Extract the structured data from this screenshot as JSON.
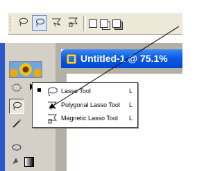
{
  "document": {
    "title": "Untitled-1 @ 75.1%"
  },
  "flyout_menu": {
    "items": [
      {
        "label": "Lasso Tool",
        "shortcut": "L",
        "icon": "lasso-icon",
        "active": true
      },
      {
        "label": "Polygonal Lasso Tool",
        "shortcut": "L",
        "icon": "polygonal-lasso-icon",
        "active": false
      },
      {
        "label": "Magnetic Lasso Tool",
        "shortcut": "L",
        "icon": "magnetic-lasso-icon",
        "active": false
      }
    ]
  },
  "options_bar": {
    "tool_icons": [
      "lasso-icon",
      "polygonal-lasso-icon",
      "magnetic-lasso-icon"
    ],
    "selection_mode_icons": [
      "new-selection-icon",
      "add-to-selection-icon",
      "subtract-from-selection-icon"
    ]
  },
  "toolbox": {
    "logo_icon": "sunflower-logo-icon",
    "tool_icons": [
      "marquee-icon",
      "move-icon",
      "lasso-icon",
      "magic-wand-icon",
      "healing-brush-icon",
      "paint-bucket-icon"
    ]
  },
  "colors": {
    "titlebar": "#0a5be6",
    "toolbox_accent": "#2a57c9",
    "menu_highlight": "#316ac5"
  }
}
